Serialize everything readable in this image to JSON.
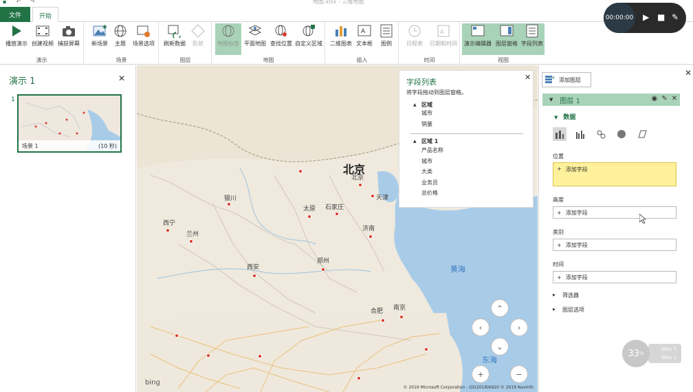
{
  "window": {
    "title": "地图.xlsx - 三维地图"
  },
  "qat": {
    "undo": "↶",
    "redo": "↷"
  },
  "tabs": {
    "file": "文件",
    "home": "开始"
  },
  "ribbon": {
    "groups": {
      "tour": "演示",
      "scene": "场景",
      "layer": "图层",
      "map": "地图",
      "insert": "插入",
      "time": "时间",
      "view": "视图"
    },
    "buttons": {
      "play_tour": "播放演示",
      "create_video": "创建视频",
      "capture_screen": "捕获屏幕",
      "new_scene": "新场景",
      "theme": "主题",
      "scene_options": "场景选项",
      "refresh_data": "刷新数据",
      "shapes": "形状",
      "map_labels": "地图标签",
      "flat_map": "平面地图",
      "find_location": "查找位置",
      "custom_regions": "自定义区域",
      "chart_2d": "二维图表",
      "text_box": "文本框",
      "legend": "图例",
      "timeline": "日程表",
      "date_time": "日期和时间",
      "tour_editor": "演示编辑器",
      "layer_pane": "图层窗格",
      "field_list": "字段列表"
    }
  },
  "tour_pane": {
    "title": "演示 1",
    "close": "✕",
    "scenes": [
      {
        "index": "1",
        "name": "场景 1",
        "duration": "(10 秒)"
      }
    ]
  },
  "map": {
    "cities": [
      {
        "name": "北京",
        "label": "北京"
      },
      {
        "name": "天津",
        "label": "天津"
      },
      {
        "name": "银川",
        "label": "银川"
      },
      {
        "name": "太原",
        "label": "太原"
      },
      {
        "name": "石家庄",
        "label": "石家庄"
      },
      {
        "name": "西宁",
        "label": "西宁"
      },
      {
        "name": "兰州",
        "label": "兰州"
      },
      {
        "name": "济南",
        "label": "济南"
      },
      {
        "name": "西安",
        "label": "西安"
      },
      {
        "name": "郑州",
        "label": "郑州"
      },
      {
        "name": "合肥",
        "label": "合肥"
      },
      {
        "name": "南京",
        "label": "南京"
      }
    ],
    "big_label": "北京",
    "seas": {
      "yellow_sea": "黄海",
      "east_sea": "东海"
    },
    "bing": "bing",
    "copyright": "© 2019 Microsoft Corporation - GS(2018)6920  © 2019 NavInfo"
  },
  "field_list": {
    "title": "字段列表",
    "hint": "将字段拖动到图层窗格。",
    "close": "✕",
    "sections": [
      {
        "name": "区域",
        "fields": [
          "城市",
          "销量"
        ]
      },
      {
        "name": "区域 1",
        "fields": [
          "产品名称",
          "城市",
          "大类",
          "业务员",
          "总价格"
        ]
      }
    ]
  },
  "layer_pane": {
    "add_layer": "添加图层",
    "close": "✕",
    "layer_name": "图层 1",
    "data_header": "数据",
    "fields": [
      {
        "label": "位置",
        "placeholder": "添加字段"
      },
      {
        "label": "高度",
        "placeholder": "添加字段"
      },
      {
        "label": "类别",
        "placeholder": "添加字段"
      },
      {
        "label": "时间",
        "placeholder": "添加字段"
      }
    ],
    "filters": "筛选器",
    "layer_options": "图层选项"
  },
  "recorder": {
    "time": "00:00:00"
  },
  "perf": {
    "percent": "33",
    "unit": "%",
    "up": "0K/s",
    "down": "0K/s"
  },
  "colors": {
    "accent": "#217346",
    "highlight": "#a9d3b8",
    "marker": "#d83b2b",
    "sea": "#a8cce8"
  }
}
